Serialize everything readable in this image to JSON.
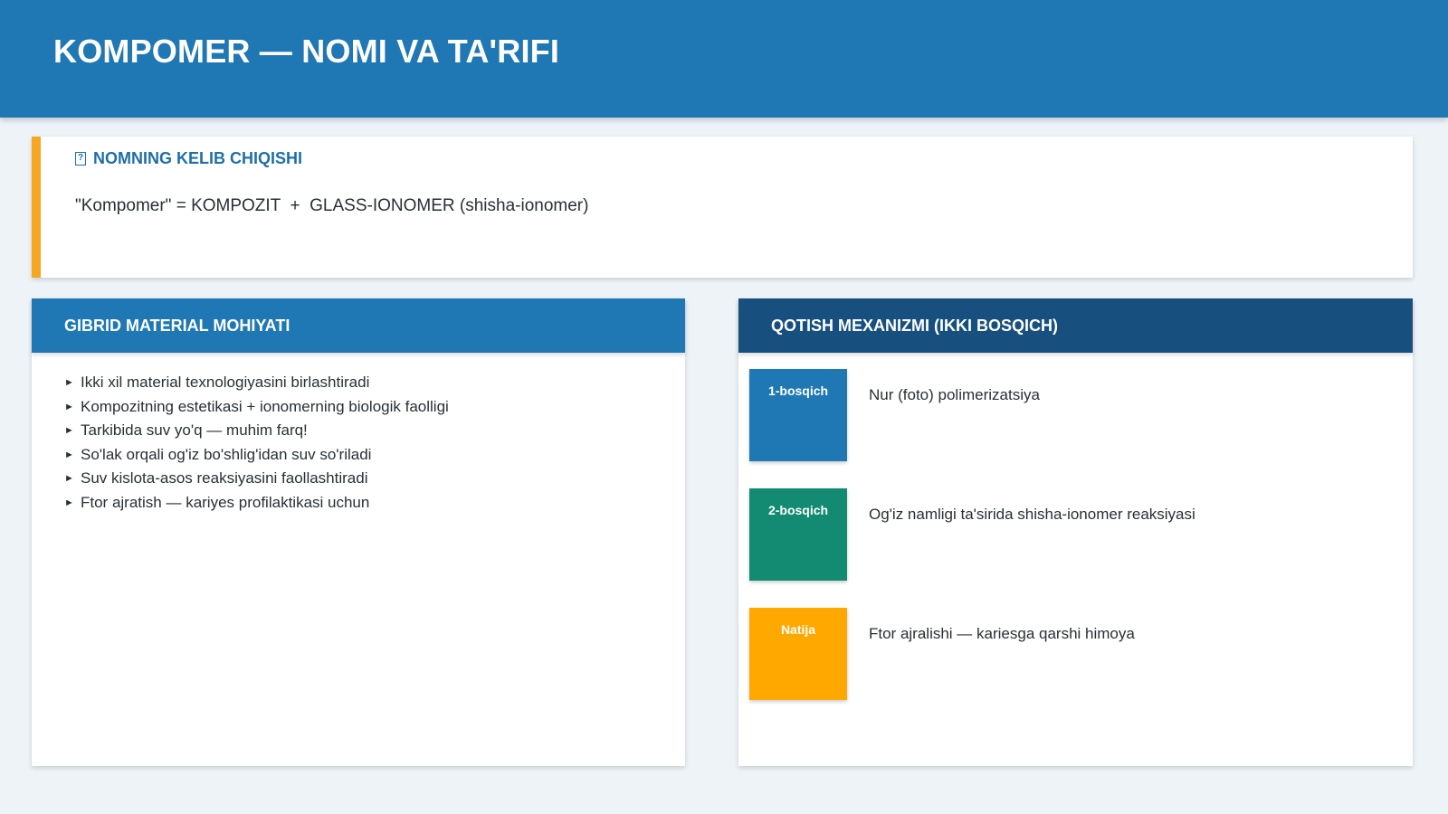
{
  "header": {
    "title": "KOMPOMER — NOMI VA TA'RIFI"
  },
  "origin": {
    "icon": "bookmark-icon",
    "icon_glyph": "?",
    "heading": "NOMNING KELIB CHIQISHI",
    "formula": "\"Kompomer\" = KOMPOZIT  +  GLASS-IONOMER (shisha-ionomer)",
    "accent_color": "#f5a623"
  },
  "left_panel": {
    "title": "GIBRID MATERIAL MOHIYATI",
    "bullet_glyph": "►",
    "items": [
      "Ikki xil material texnologiyasini birlashtiradi",
      "Kompozitning estetikasi + ionomerning biologik faolligi",
      "Tarkibida suv yo'q — muhim farq!",
      "So'lak orqali og'iz bo'shlig'idan suv so'riladi",
      "Suv kislota-asos reaksiyasini faollashtiradi",
      "Ftor ajratish — kariyes profilaktikasi uchun"
    ]
  },
  "right_panel": {
    "title": "QOTISH MEXANIZMI (IKKI BOSQICH)",
    "steps": [
      {
        "label": "1-bosqich",
        "text": "Nur (foto) polimerizatsiya",
        "color": "#1f78b4"
      },
      {
        "label": "2-bosqich",
        "text": "Og'iz namligi ta'sirida shisha-ionomer reaksiyasi",
        "color": "#138a72"
      },
      {
        "label": "Natija",
        "text": "Ftor ajralishi — kariesga qarshi himoya",
        "color": "#ffa800"
      }
    ]
  },
  "colors": {
    "header": "#1f78b4",
    "right_header": "#17507e",
    "background": "#eef3f8"
  }
}
